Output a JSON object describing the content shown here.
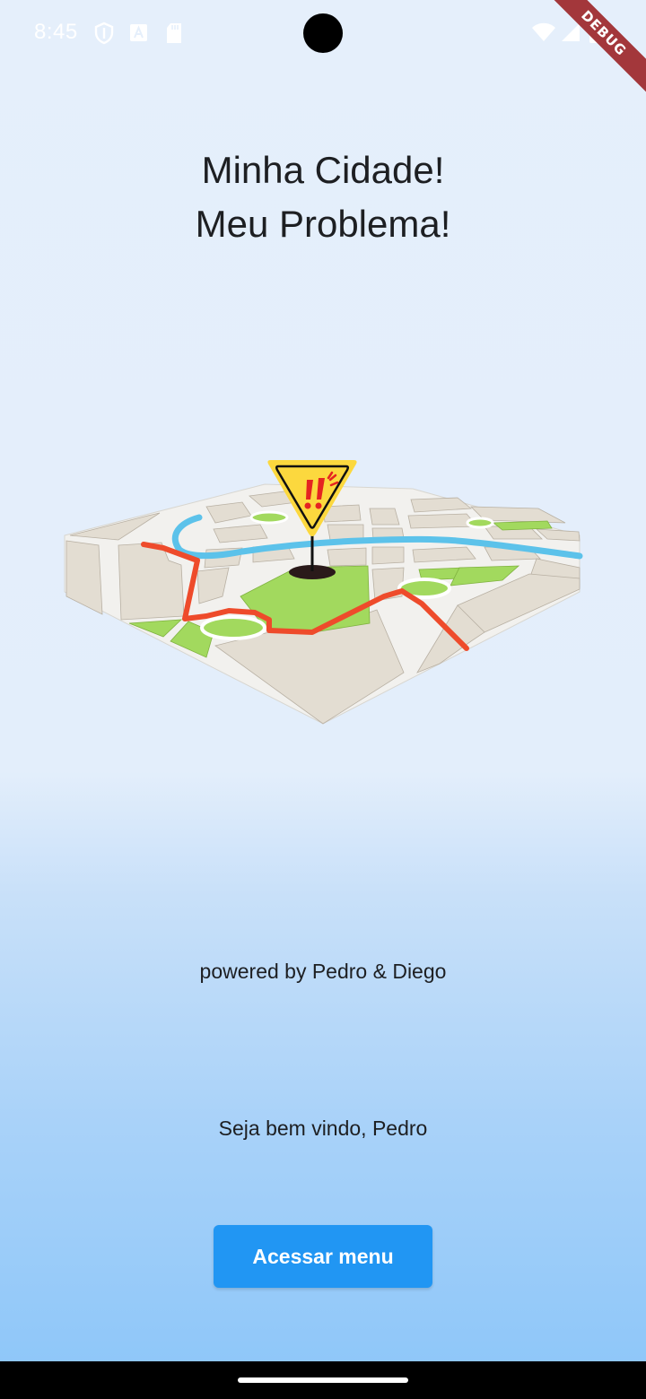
{
  "status_bar": {
    "time": "8:45",
    "icons": [
      "shield-icon",
      "text-a-icon",
      "sd-card-icon",
      "wifi-icon",
      "signal-icon",
      "battery-icon"
    ]
  },
  "debug_banner": {
    "label": "DEBUG"
  },
  "header": {
    "title_line1": "Minha Cidade!",
    "title_line2": "Meu Problema!"
  },
  "illustration": {
    "icon": "city-map-problem-illustration"
  },
  "footer": {
    "powered_by": "powered by Pedro & Diego",
    "welcome": "Seja bem vindo, Pedro",
    "menu_button_label": "Acessar menu"
  },
  "colors": {
    "accent": "#2196f3",
    "background_top": "#e5effb",
    "background_bottom": "#8fc7f9",
    "route": "#ee4b2b",
    "park": "#a2d95e",
    "water": "#5cc2ea",
    "block": "#e3ddd2",
    "warning_sign": "#fcd83e"
  }
}
